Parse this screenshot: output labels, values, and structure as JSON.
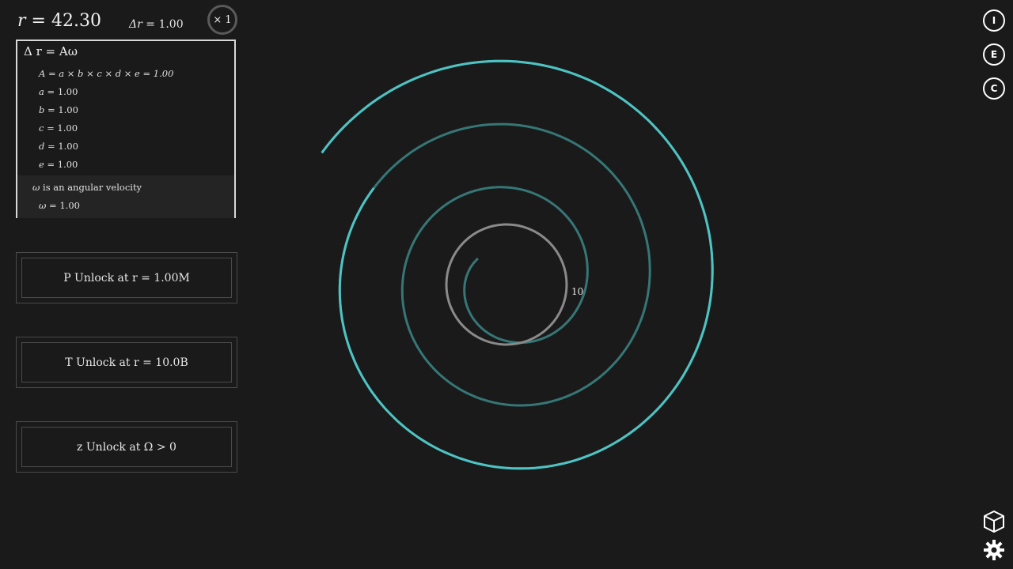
{
  "header": {
    "r_label": "r",
    "r_value": "42.30",
    "dr_label": "Δr",
    "dr_value": "1.00",
    "multiplier": "× 1"
  },
  "formula": {
    "title": "Δ r = Aω",
    "A_row": "A = a × b × c × d × e = 1.00",
    "vars": [
      {
        "name": "a",
        "value": "1.00"
      },
      {
        "name": "b",
        "value": "1.00"
      },
      {
        "name": "c",
        "value": "1.00"
      },
      {
        "name": "d",
        "value": "1.00"
      },
      {
        "name": "e",
        "value": "1.00"
      }
    ],
    "omega_desc_sym": "ω",
    "omega_desc_text": "is an angular velocity",
    "omega_name": "ω",
    "omega_value": "1.00"
  },
  "unlocks": [
    {
      "label": "P Unlock at r = 1.00M"
    },
    {
      "label": "T Unlock at r = 10.0B"
    },
    {
      "label": "z Unlock at Ω  >  0"
    }
  ],
  "side_buttons": {
    "info": "I",
    "e": "E",
    "c": "C"
  },
  "spiral": {
    "marker_label": "10",
    "accent_color": "#4ec3c3",
    "ring_color": "#8a8a8a"
  }
}
